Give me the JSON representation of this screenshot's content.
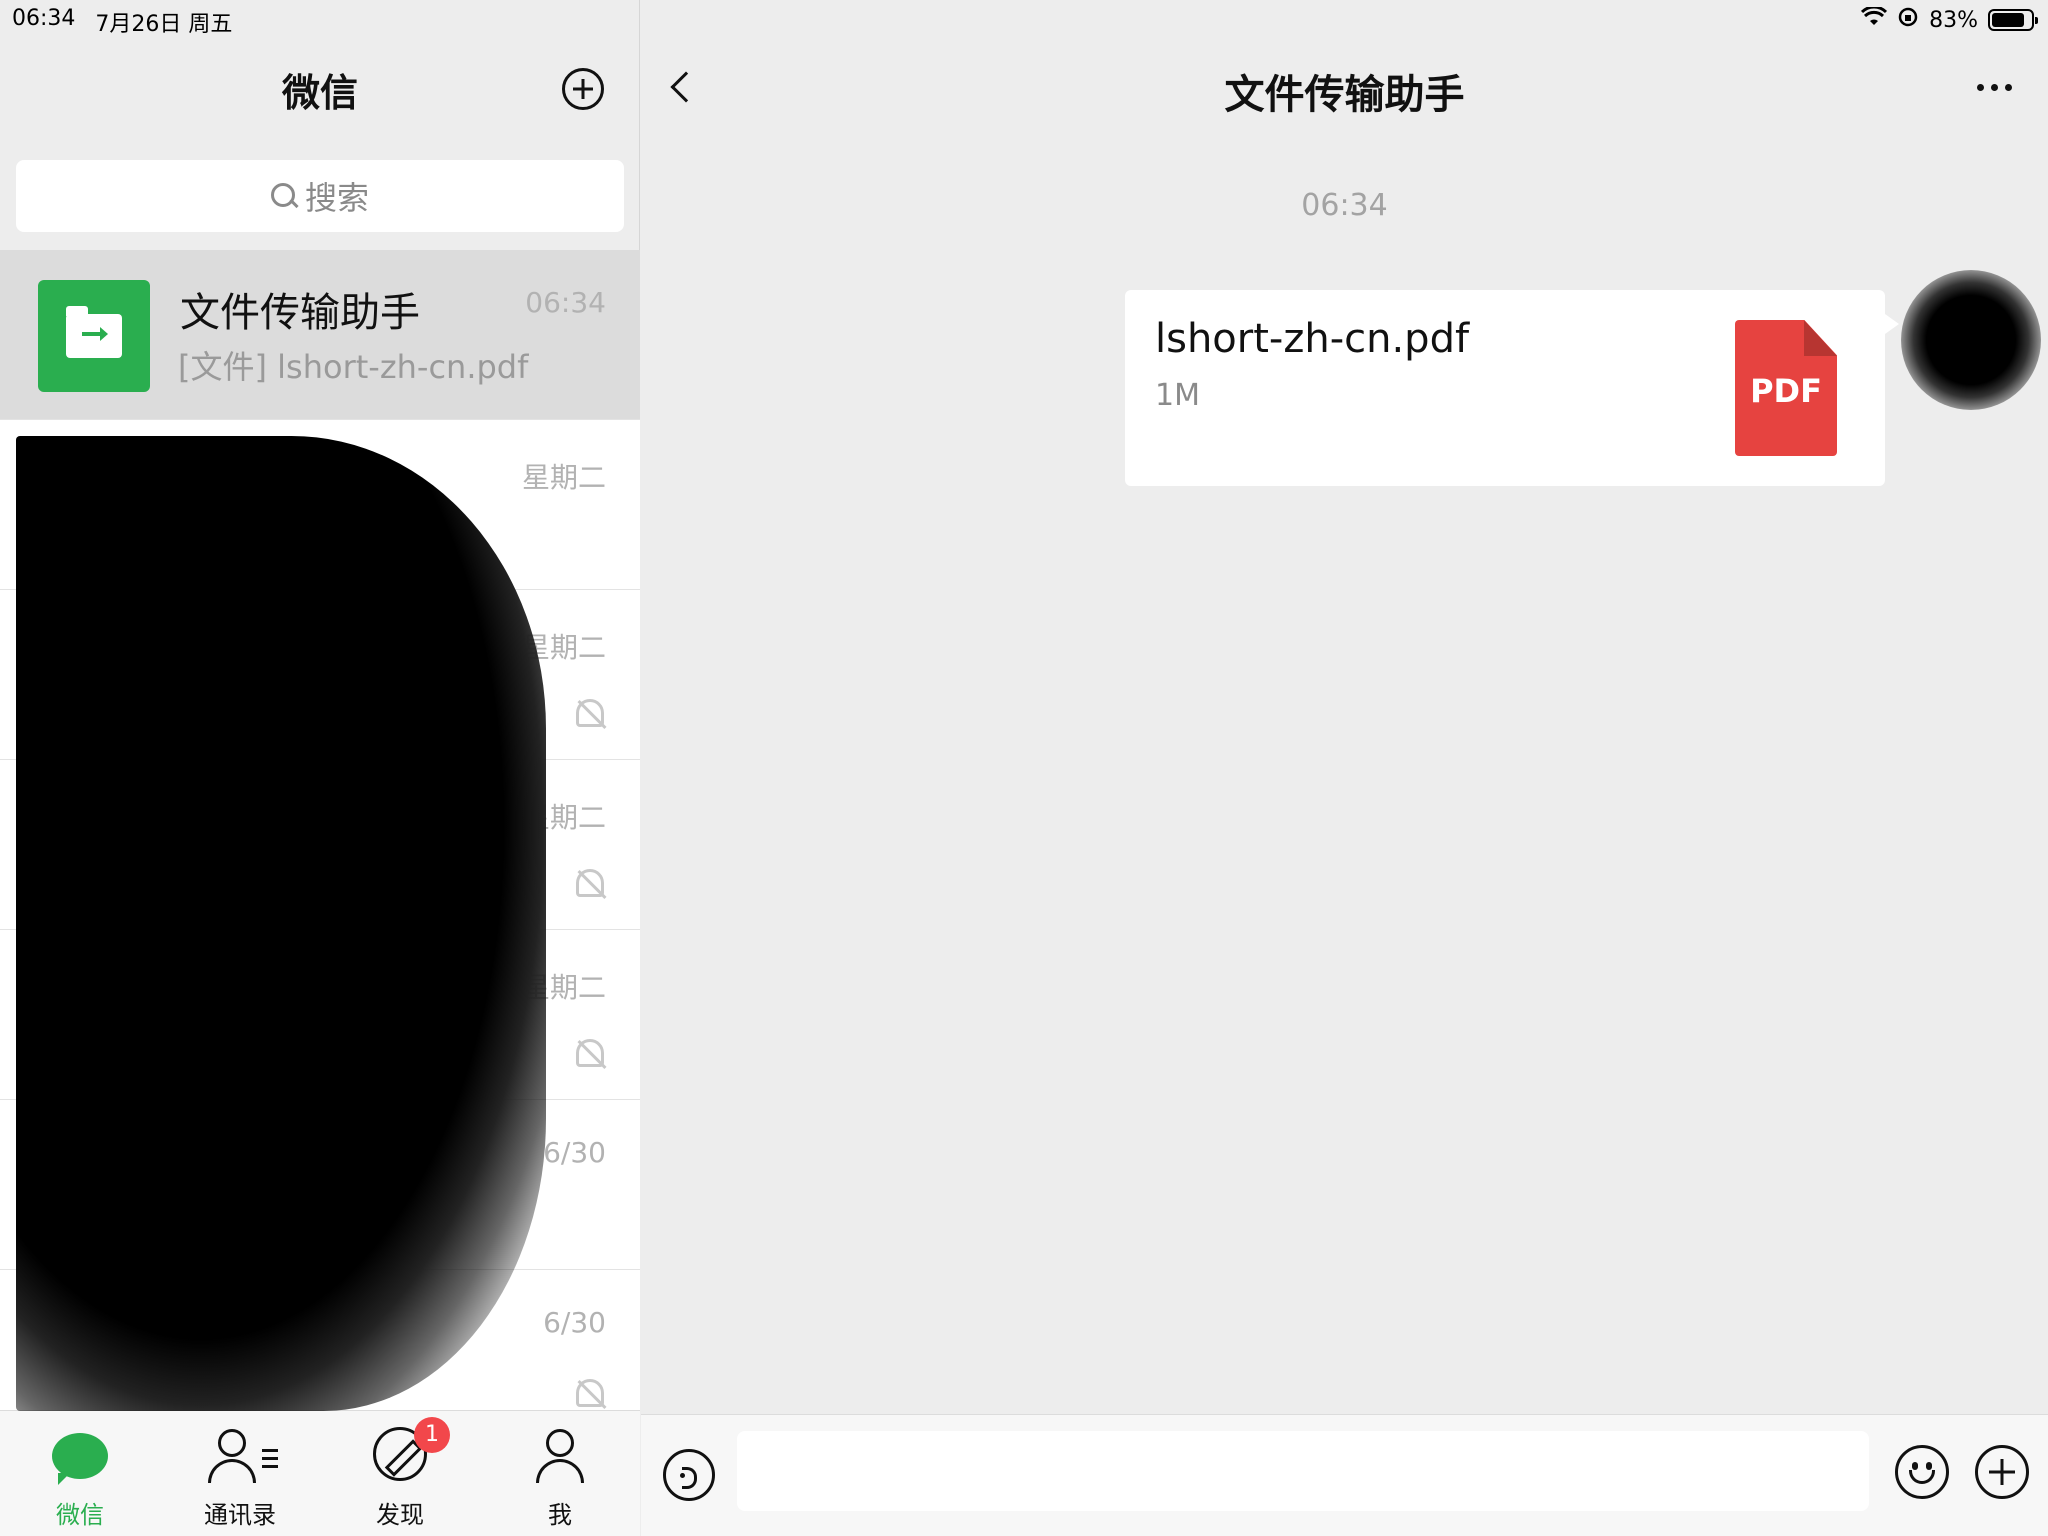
{
  "status_bar": {
    "time": "06:34",
    "date": "7月26日 周五",
    "battery_percent": "83%",
    "battery_level": 0.83
  },
  "sidebar": {
    "title": "微信",
    "search_placeholder": "搜索",
    "chats": [
      {
        "name": "文件传输助手",
        "preview": "[文件] lshort-zh-cn.pdf",
        "time": "06:34",
        "muted": false,
        "active": true
      },
      {
        "name": "",
        "preview": "",
        "time": "星期二",
        "muted": false,
        "active": false
      },
      {
        "name": "",
        "preview": "",
        "time": "星期二",
        "muted": true,
        "active": false
      },
      {
        "name": "",
        "preview": "",
        "time": "星期二",
        "muted": true,
        "active": false
      },
      {
        "name": "",
        "preview": "",
        "time": "星期二",
        "muted": true,
        "active": false
      },
      {
        "name": "",
        "preview": "",
        "time": "6/30",
        "muted": false,
        "active": false
      },
      {
        "name": "",
        "preview": "",
        "time": "6/30",
        "muted": true,
        "active": false
      }
    ]
  },
  "tabbar": {
    "tabs": [
      {
        "label": "微信",
        "icon": "chat-bubble-icon",
        "active": true
      },
      {
        "label": "通讯录",
        "icon": "contacts-icon",
        "active": false
      },
      {
        "label": "发现",
        "icon": "compass-icon",
        "active": false,
        "badge": "1"
      },
      {
        "label": "我",
        "icon": "person-icon",
        "active": false
      }
    ]
  },
  "chat": {
    "title": "文件传输助手",
    "message_time": "06:34",
    "message": {
      "file_name": "lshort-zh-cn.pdf",
      "file_size": "1M",
      "file_type_label": "PDF"
    },
    "input_placeholder": ""
  },
  "colors": {
    "accent": "#2aae4f",
    "pdf_red": "#e64340",
    "badge_red": "#f2474b",
    "background": "#ededed"
  }
}
